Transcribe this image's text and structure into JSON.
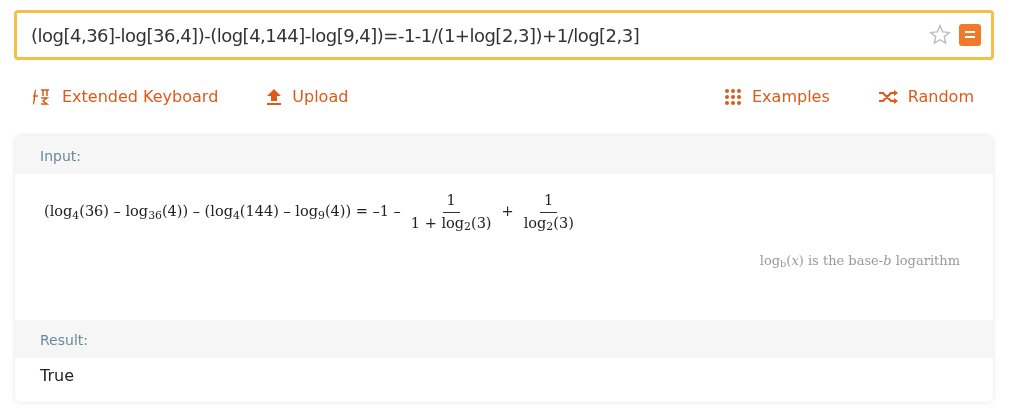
{
  "query": {
    "value": "(log[4,36]-log[36,4])-(log[4,144]-log[9,4])=-1-1/(1+log[2,3])+1/log[2,3]",
    "favorite": false
  },
  "links_left": [
    {
      "kind": "keyboard",
      "label": "Extended Keyboard"
    },
    {
      "kind": "upload",
      "label": "Upload"
    }
  ],
  "links_right": [
    {
      "kind": "examples",
      "label": "Examples"
    },
    {
      "kind": "random",
      "label": "Random"
    }
  ],
  "pods": [
    {
      "title": "Input:",
      "kind": "math",
      "formula": [
        {
          "kind": "text",
          "text": "(log$_{4}$(36) – log$_{36}$(4)) – (log$_{4}$(144) – log$_{9}$(4)) = –1 –"
        },
        {
          "kind": "fraction",
          "numerator": "1",
          "denominator": "1 + log$_{2}$(3)"
        },
        {
          "kind": "text",
          "text": "+"
        },
        {
          "kind": "fraction",
          "numerator": "1",
          "denominator": "log$_{2}$(3)"
        }
      ],
      "note": "log$_{b}$(*x*) is the base-*b* logarithm"
    },
    {
      "title": "Result:",
      "kind": "plain",
      "text": "True"
    }
  ]
}
